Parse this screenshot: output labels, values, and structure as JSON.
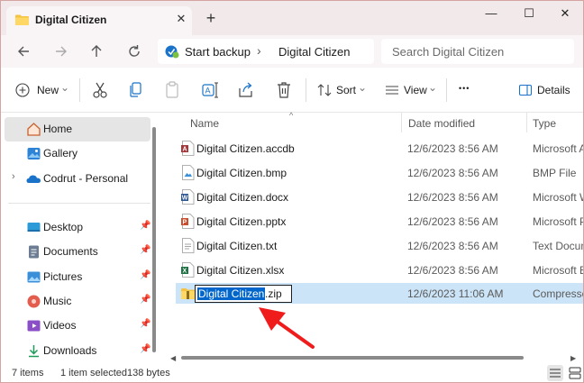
{
  "window": {
    "tab_title": "Digital Citizen",
    "new_tab_glyph": "+",
    "close_tab_glyph": "✕",
    "minimize_glyph": "—",
    "maximize_glyph": "☐",
    "close_glyph": "✕"
  },
  "address": {
    "breadcrumbs": [
      "Start backup",
      "Digital Citizen"
    ],
    "separator": "›",
    "search_placeholder": "Search Digital Citizen"
  },
  "toolbar": {
    "new_label": "New",
    "sort_label": "Sort",
    "view_label": "View",
    "more_glyph": "•••",
    "details_label": "Details",
    "dropdown_glyph": "⌄"
  },
  "sidebar": {
    "items": [
      {
        "label": "Home",
        "icon": "home-icon"
      },
      {
        "label": "Gallery",
        "icon": "gallery-icon"
      },
      {
        "label": "Codrut - Personal",
        "icon": "onedrive-icon"
      },
      {
        "label": "Desktop",
        "icon": "desktop-icon"
      },
      {
        "label": "Documents",
        "icon": "documents-icon"
      },
      {
        "label": "Pictures",
        "icon": "pictures-icon"
      },
      {
        "label": "Music",
        "icon": "music-icon"
      },
      {
        "label": "Videos",
        "icon": "videos-icon"
      },
      {
        "label": "Downloads",
        "icon": "downloads-icon"
      }
    ],
    "expand_glyph": "›",
    "pin_glyph": "📌"
  },
  "filelist": {
    "columns": [
      "Name",
      "Date modified",
      "Type"
    ],
    "sort_glyph": "^",
    "files": [
      {
        "name": "Digital Citizen.accdb",
        "date": "12/6/2023 8:56 AM",
        "type": "Microsoft Ac",
        "icon": "access-file-icon"
      },
      {
        "name": "Digital Citizen.bmp",
        "date": "12/6/2023 8:56 AM",
        "type": "BMP File",
        "icon": "image-file-icon"
      },
      {
        "name": "Digital Citizen.docx",
        "date": "12/6/2023 8:56 AM",
        "type": "Microsoft Wo",
        "icon": "word-file-icon"
      },
      {
        "name": "Digital Citizen.pptx",
        "date": "12/6/2023 8:56 AM",
        "type": "Microsoft Po",
        "icon": "powerpoint-file-icon"
      },
      {
        "name": "Digital Citizen.txt",
        "date": "12/6/2023 8:56 AM",
        "type": "Text Docume",
        "icon": "text-file-icon"
      },
      {
        "name": "Digital Citizen.xlsx",
        "date": "12/6/2023 8:56 AM",
        "type": "Microsoft Exc",
        "icon": "excel-file-icon"
      }
    ],
    "renaming": {
      "selected_text": "Digital Citizen",
      "rest_text": ".zip",
      "date": "12/6/2023 11:06 AM",
      "type": "Compressed",
      "icon": "zip-folder-icon"
    }
  },
  "status": {
    "item_count": "7 items",
    "selection": "1 item selected",
    "size": "138 bytes"
  },
  "colors": {
    "accent": "#0066cc",
    "selection_bg": "#cce4f7",
    "annotation_arrow": "#f01c1c"
  }
}
